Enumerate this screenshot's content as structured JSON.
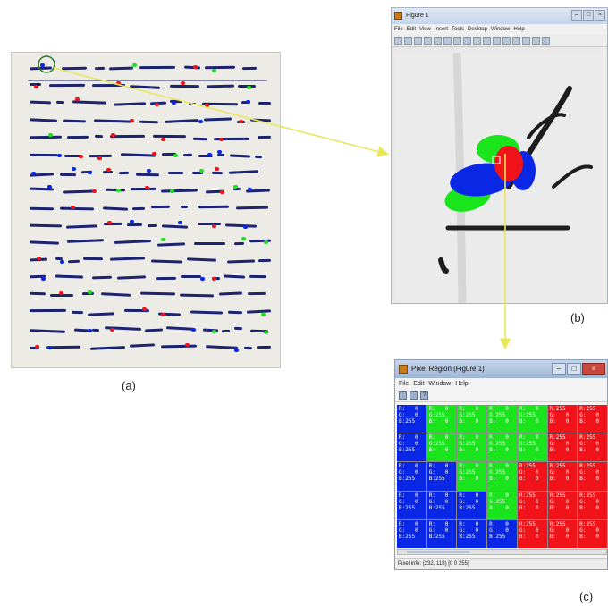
{
  "captions": {
    "a": "(a)",
    "b": "(b)",
    "c": "(c)"
  },
  "figure_window": {
    "title": "Figure 1",
    "menu": [
      "File",
      "Edit",
      "View",
      "Insert",
      "Tools",
      "Desktop",
      "Window",
      "Help"
    ]
  },
  "pixel_region_window": {
    "title": "Pixel Region (Figure 1)",
    "menu": [
      "File",
      "Edit",
      "Window",
      "Help"
    ],
    "status": "Pixel info: (232, 118)  [0 0 255]",
    "rows": [
      [
        "b",
        "g",
        "g",
        "g",
        "g",
        "r",
        "r"
      ],
      [
        "b",
        "g",
        "g",
        "g",
        "g",
        "r",
        "r"
      ],
      [
        "b",
        "b",
        "g",
        "g",
        "r",
        "r",
        "r"
      ],
      [
        "b",
        "b",
        "b",
        "g",
        "r",
        "r",
        "r"
      ],
      [
        "b",
        "b",
        "b",
        "b",
        "r",
        "r",
        "r"
      ]
    ],
    "cell_text": {
      "b": "R:   0\nG:   0\nB:255",
      "g": "R:   0\nG:255\nB:   0",
      "r": "R:255\nG:   0\nB:   0"
    }
  },
  "colors": {
    "blue": "#0a27e6",
    "green": "#19e41c",
    "red": "#f0131a",
    "arrow": "#e8e85a"
  }
}
